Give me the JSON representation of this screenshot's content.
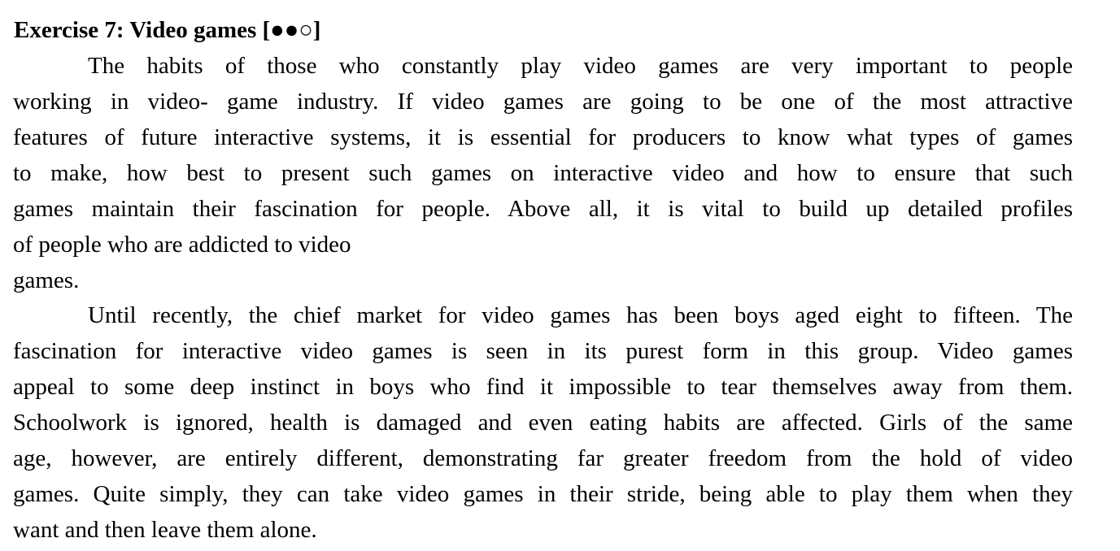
{
  "exercise": {
    "title": "Exercise 7: Video games [●●○]",
    "paragraphs": [
      {
        "lines": [
          "The habits of those who constantly play video games are very important to people",
          "working in video- game industry. If video games are going to be one of the most attractive",
          "features of future interactive systems, it is essential for producers to know what types of games",
          "to make, how best to present such games on interactive  video and how to ensure that such",
          "games maintain their fascination for people. Above all, it is vital to build up detailed profiles",
          "of people who are addicted to  video",
          "games."
        ]
      },
      {
        "lines": [
          "Until recently, the chief market for video games has been boys aged eight to fifteen. The",
          "fascination for interactive video games is seen in its purest form in this group. Video games",
          "appeal to some deep instinct in boys who find it impossible to tear themselves away from them.",
          "Schoolwork is ignored, health is damaged and even eating habits are affected. Girls of the same",
          "age, however, are entirely different, demonstrating far greater freedom from the hold of video",
          "games. Quite simply, they can take video games in their stride, being able to play them when they",
          "want and then leave them alone."
        ]
      }
    ]
  }
}
